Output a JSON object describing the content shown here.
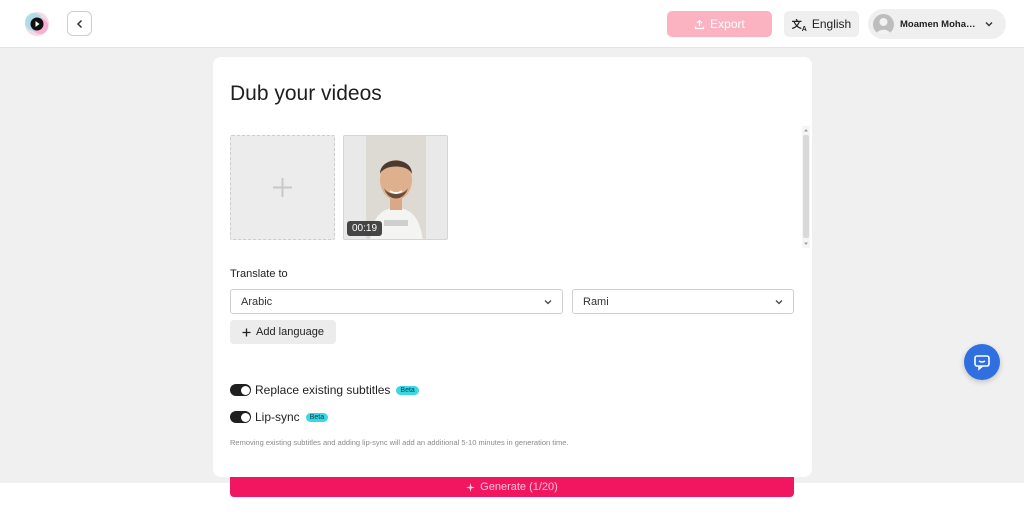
{
  "header": {
    "logo_icon": "app-logo-icon",
    "back_icon": "chevron-left-icon",
    "export_label": "Export",
    "export_icon": "upload-icon",
    "language_label": "English",
    "language_icon": "translate-icon",
    "user_name": "Moamen Moham…",
    "user_chevron_icon": "chevron-down-icon"
  },
  "panel": {
    "title": "Dub your videos",
    "add_video_icon": "plus-icon",
    "video": {
      "duration": "00:19"
    },
    "translate_label": "Translate to",
    "language_select": {
      "value": "Arabic"
    },
    "voice_select": {
      "value": "Rami"
    },
    "add_language_label": "Add language",
    "replace_subtitles": {
      "label": "Replace existing subtitles",
      "badge": "Beta",
      "enabled": true
    },
    "lip_sync": {
      "label": "Lip-sync",
      "badge": "Beta",
      "enabled": true
    },
    "note": "Removing existing subtitles and adding lip-sync will add an additional 5-10 minutes in generation time."
  },
  "footer": {
    "generate_label": "Generate (1/20)",
    "generate_icon": "sparkle-icon"
  },
  "chat_icon": "chat-icon",
  "colors": {
    "accent": "#f2155f",
    "export_disabled": "#fbb3c2",
    "chat_button": "#2f6fe0",
    "beta_badge": "#3ad7e6"
  }
}
